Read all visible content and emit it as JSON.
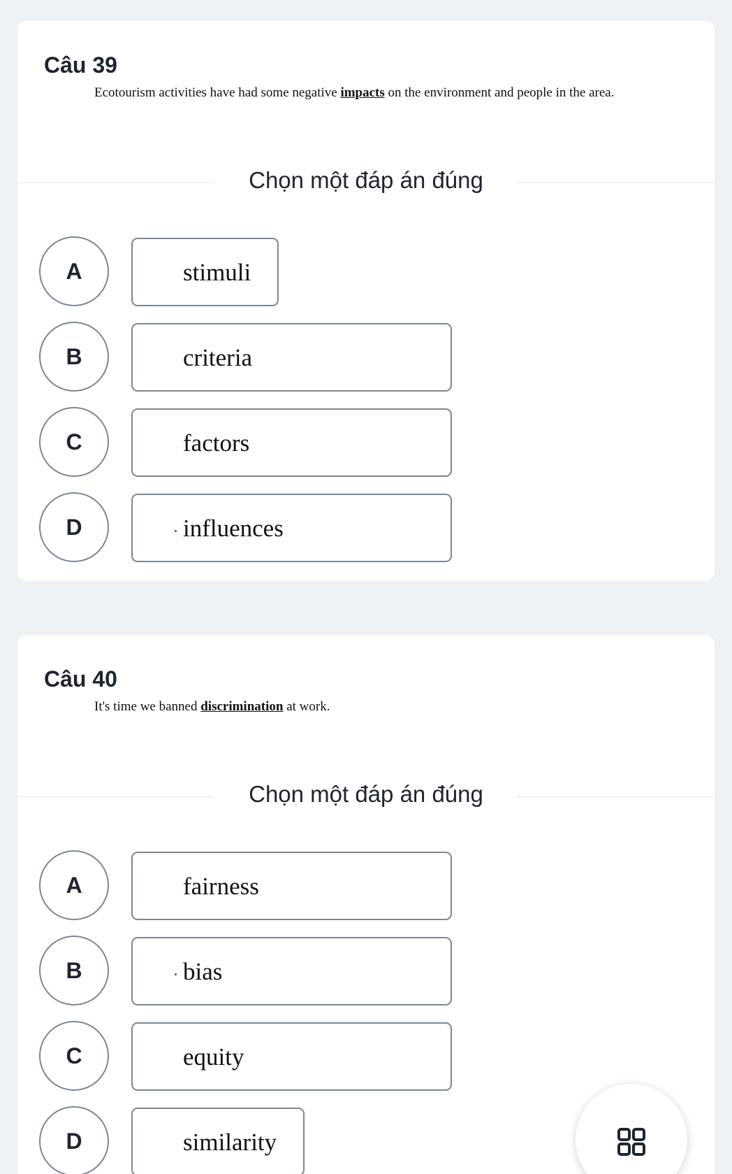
{
  "questions": [
    {
      "title": "Câu 39",
      "text_before": "Ecotourism activities have had some negative ",
      "keyword": "impacts",
      "text_after": " on the environment and people in the area.",
      "instruction": "Chọn một đáp án đúng",
      "options": [
        {
          "letter": "A",
          "text": "stimuli"
        },
        {
          "letter": "B",
          "text": "criteria"
        },
        {
          "letter": "C",
          "text": "factors"
        },
        {
          "letter": "D",
          "text": "influences"
        }
      ]
    },
    {
      "title": "Câu 40",
      "text_before": "It's time we banned ",
      "keyword": "discrimination",
      "text_after": " at work.",
      "instruction": "Chọn một đáp án đúng",
      "options": [
        {
          "letter": "A",
          "text": "fairness"
        },
        {
          "letter": "B",
          "text": "bias"
        },
        {
          "letter": "C",
          "text": "equity"
        },
        {
          "letter": "D",
          "text": "similarity"
        }
      ]
    }
  ],
  "fab": {
    "icon": "grid-icon"
  },
  "colors": {
    "background": "#eef1f6",
    "card": "#ffffff",
    "border": "#7d8694",
    "text": "#1f2430"
  }
}
